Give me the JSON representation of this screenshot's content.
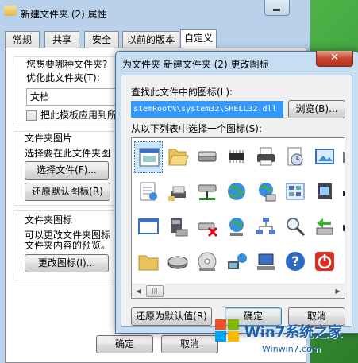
{
  "props_window": {
    "title": "新建文件夹 (2) 属性",
    "tabs": [
      "常规",
      "共享",
      "安全",
      "以前的版本",
      "自定义"
    ],
    "active_tab": "自定义",
    "optimize_question": "您想要哪种文件夹?",
    "optimize_label": "优化此文件夹(T):",
    "optimize_value": "文档",
    "template_checkbox_label": "把此模板应用到所",
    "folder_pictures_group": "文件夹图片",
    "select_file_text": "选择要在此文件夹图",
    "choose_file_button": "选择文件(F)...",
    "restore_default_image_button": "还原默认图标(R)",
    "folder_icons_group": "文件夹图标",
    "folder_icons_desc_1": "可以更改文件夹图标",
    "folder_icons_desc_2": "文件夹内容的预览。",
    "change_icon_button": "更改图标(I)...",
    "ok_button": "确定",
    "cancel_button": "取消"
  },
  "change_icon_dialog": {
    "title": "为文件夹 新建文件夹 (2) 更改图标",
    "close_glyph": "✕",
    "find_label": "查找此文件中的图标(L):",
    "path_value": "stemRoot%\\system32\\SHELL32.dll",
    "browse_button": "浏览(B)...",
    "select_label": "从以下列表中选择一个图标(S):",
    "restore_defaults_button": "还原为默认值(R)",
    "ok_button": "确定",
    "cancel_button": "取消",
    "scroll_thumb_glyph": "|||",
    "icons": [
      [
        "document-window-icon",
        "shield-settings-icon",
        "folder-open-icon",
        "mail-icon"
      ],
      [
        "folder-icon",
        "network-doc-icon",
        "drive-icon",
        "globe-icon"
      ],
      [
        "chip-icon",
        "drive-network-icon",
        "drive-x-icon",
        "cd-icon"
      ],
      [
        "printer-icon",
        "drive-network-icon",
        "network-icon",
        "monitor-icon"
      ],
      [
        "clock-doc-icon",
        "globe-icon",
        "magnifier-icon",
        "grid-doc-icon"
      ],
      [
        "image-icon",
        "app-window-icon",
        "green-arrow-icon",
        "help-icon"
      ],
      [
        "network-computer-icon",
        "grid-icon",
        "power-icon"
      ]
    ]
  },
  "watermark": {
    "brand": "Win7系统之家",
    "url": "Winwin7.com"
  }
}
